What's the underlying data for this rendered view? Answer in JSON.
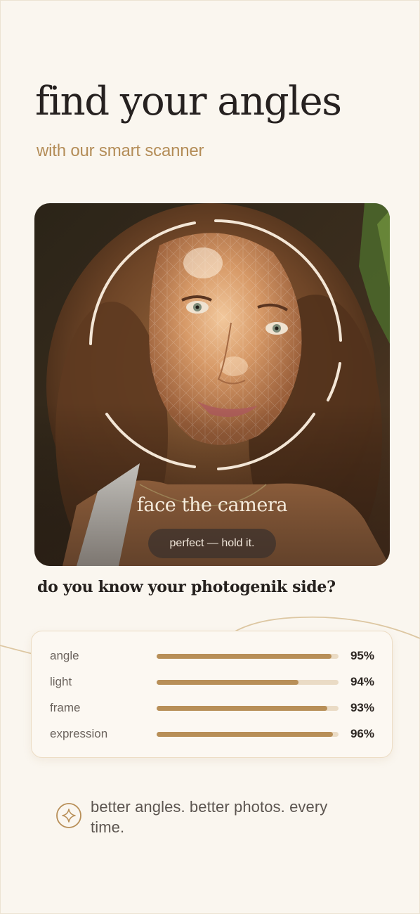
{
  "header": {
    "title": "find your angles",
    "subtitle": "with our smart scanner"
  },
  "scanner": {
    "instruction": "face the camera",
    "status": "perfect — hold it."
  },
  "question": "do you know your photogenik side?",
  "metrics": [
    {
      "label": "angle",
      "value": "95%",
      "fill": 0.96
    },
    {
      "label": "light",
      "value": "94%",
      "fill": 0.78
    },
    {
      "label": "frame",
      "value": "93%",
      "fill": 0.94
    },
    {
      "label": "expression",
      "value": "96%",
      "fill": 0.97
    }
  ],
  "tagline": {
    "text": "better angles. better photos. every time.",
    "icon": "sparkle-icon"
  },
  "colors": {
    "background": "#faf6ef",
    "accent": "#b88f58",
    "track": "#eadbc5",
    "title": "#262120"
  }
}
